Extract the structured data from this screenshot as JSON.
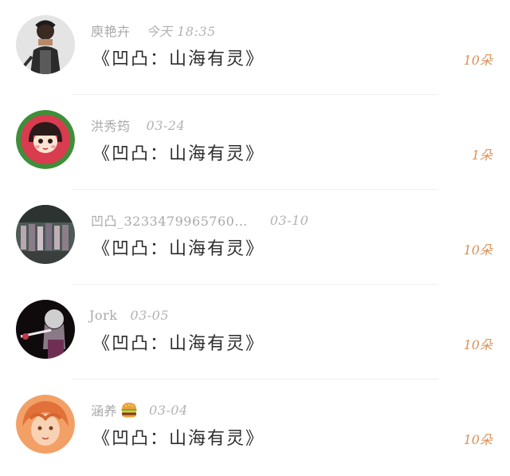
{
  "comments": [
    {
      "name": "庾艳卉",
      "time": "今天 18:35",
      "text": "《凹凸：山海有灵》",
      "count": "10朵",
      "avatar_icon": "rocker-avatar-icon"
    },
    {
      "name": "洪秀筠",
      "time": "03-24",
      "text": "《凹凸：山海有灵》",
      "count": "1朵",
      "avatar_icon": "cartoon-girl-avatar-icon"
    },
    {
      "name": "凹凸_3233479965760…",
      "time": "03-10",
      "text": "《凹凸：山海有灵》",
      "count": "10朵",
      "avatar_icon": "crowd-photo-avatar-icon"
    },
    {
      "name": "Jork",
      "time": "03-05",
      "text": "《凹凸：山海有灵》",
      "count": "10朵",
      "avatar_icon": "dark-anime-avatar-icon"
    },
    {
      "name": "涵养",
      "time": "03-04",
      "text": "《凹凸：山海有灵》",
      "count": "10朵",
      "emoji": "burger-emoji-icon",
      "avatar_icon": "orange-hair-avatar-icon"
    }
  ],
  "colors": {
    "count": "#d9925a",
    "meta": "#a9a9a9",
    "text": "#2c2c2c",
    "divider": "#f0f0f0"
  }
}
